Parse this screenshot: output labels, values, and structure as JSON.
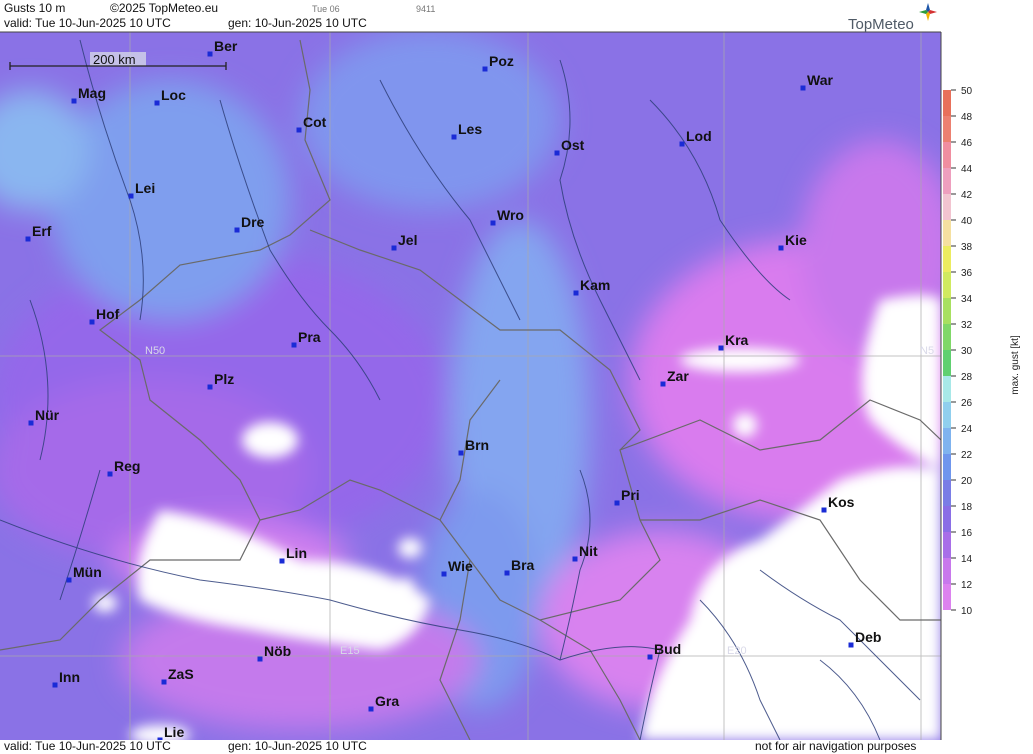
{
  "header": {
    "title": "Gusts 10 m",
    "copyright": "©2025 TopMeteo.eu",
    "run_time": "Tue 06",
    "code": "9411",
    "valid": "valid:  Tue  10-Jun-2025  10 UTC",
    "gen": "gen: 10-Jun-2025 10 UTC",
    "brand": "TopMeteo"
  },
  "footer": {
    "valid": "valid:  Tue  10-Jun-2025  10 UTC",
    "gen": "gen: 10-Jun-2025 10 UTC",
    "disclaimer": "not for air navigation purposes"
  },
  "scale_bar": {
    "label": "200 km"
  },
  "grid_labels": {
    "lat": "N50",
    "lat_right": "N5",
    "lon1": "E15",
    "lon2": "E20"
  },
  "cities": [
    {
      "name": "Ber"
    },
    {
      "name": "Poz"
    },
    {
      "name": "War"
    },
    {
      "name": "Mag"
    },
    {
      "name": "Loc"
    },
    {
      "name": "Cot"
    },
    {
      "name": "Les"
    },
    {
      "name": "Ost"
    },
    {
      "name": "Lod"
    },
    {
      "name": "Lei"
    },
    {
      "name": "Erf"
    },
    {
      "name": "Dre"
    },
    {
      "name": "Wro"
    },
    {
      "name": "Jel"
    },
    {
      "name": "Kie"
    },
    {
      "name": "Kam"
    },
    {
      "name": "Hof"
    },
    {
      "name": "Pra"
    },
    {
      "name": "Kra"
    },
    {
      "name": "Plz"
    },
    {
      "name": "Zar"
    },
    {
      "name": "Nür"
    },
    {
      "name": "Brn"
    },
    {
      "name": "Reg"
    },
    {
      "name": "Pri"
    },
    {
      "name": "Kos"
    },
    {
      "name": "Lin"
    },
    {
      "name": "Nit"
    },
    {
      "name": "Wie"
    },
    {
      "name": "Bra"
    },
    {
      "name": "Mün"
    },
    {
      "name": "Deb"
    },
    {
      "name": "Nöb"
    },
    {
      "name": "Bud"
    },
    {
      "name": "Inn"
    },
    {
      "name": "ZaS"
    },
    {
      "name": "Gra"
    },
    {
      "name": "Lie"
    }
  ],
  "legend": {
    "title": "max. gust  [kt]",
    "ticks": [
      "50",
      "48",
      "46",
      "44",
      "42",
      "40",
      "38",
      "36",
      "34",
      "32",
      "30",
      "28",
      "26",
      "24",
      "22",
      "20",
      "18",
      "16",
      "14",
      "12",
      "10"
    ],
    "colors": [
      "#e8705a",
      "#ec8070",
      "#f08ea0",
      "#ee9fbe",
      "#f2c4d0",
      "#f5e0a0",
      "#ecec60",
      "#d0ea60",
      "#a8e060",
      "#80d868",
      "#60d070",
      "#a8e8e8",
      "#90cfee",
      "#7fb3ef",
      "#6f96ed",
      "#7a7de6",
      "#8a6ee6",
      "#a86ee8",
      "#c878ec",
      "#dc82ef"
    ]
  }
}
